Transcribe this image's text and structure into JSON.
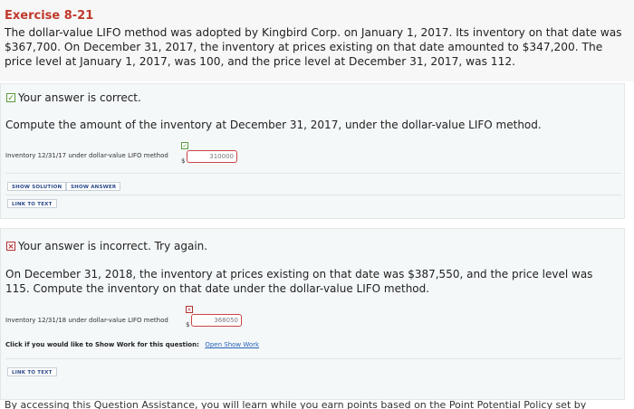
{
  "exercise": {
    "title": "Exercise 8-21",
    "problem": "The dollar-value LIFO method was adopted by Kingbird Corp. on January 1, 2017. Its inventory on that date was $367,700. On December 31, 2017, the inventory at prices existing on that date amounted to $347,200. The price level at January 1, 2017, was 100, and the price level at December 31, 2017, was 112."
  },
  "part1": {
    "status": "Your answer is correct.",
    "question": "Compute the amount of the inventory at December 31, 2017, under the dollar-value LIFO method.",
    "row_label": "Inventory 12/31/17 under dollar-value LIFO method",
    "currency": "$",
    "answer": "310000",
    "show_solution": "SHOW SOLUTION",
    "show_answer": "SHOW ANSWER",
    "link_to_text": "LINK TO TEXT"
  },
  "part2": {
    "status": "Your answer is incorrect.  Try again.",
    "question": "On December 31, 2018, the inventory at prices existing on that date was $387,550, and the price level was 115. Compute the inventory on that date under the dollar-value LIFO method.",
    "row_label": "Inventory 12/31/18 under dollar-value LIFO method",
    "currency": "$",
    "answer": "368050",
    "work_prompt": "Click if you would like to Show Work for this question:",
    "work_link": "Open Show Work",
    "link_to_text": "LINK TO TEXT"
  },
  "footer": {
    "text": "By accessing this Question Assistance, you will learn while you earn points based on the Point Potential Policy set by"
  },
  "colors": {
    "title": "#c0392b",
    "correct": "#4a8a2a",
    "incorrect": "#b03030",
    "link": "#2a62b8"
  },
  "icons": {
    "correct": "check-icon",
    "incorrect": "x-icon"
  }
}
